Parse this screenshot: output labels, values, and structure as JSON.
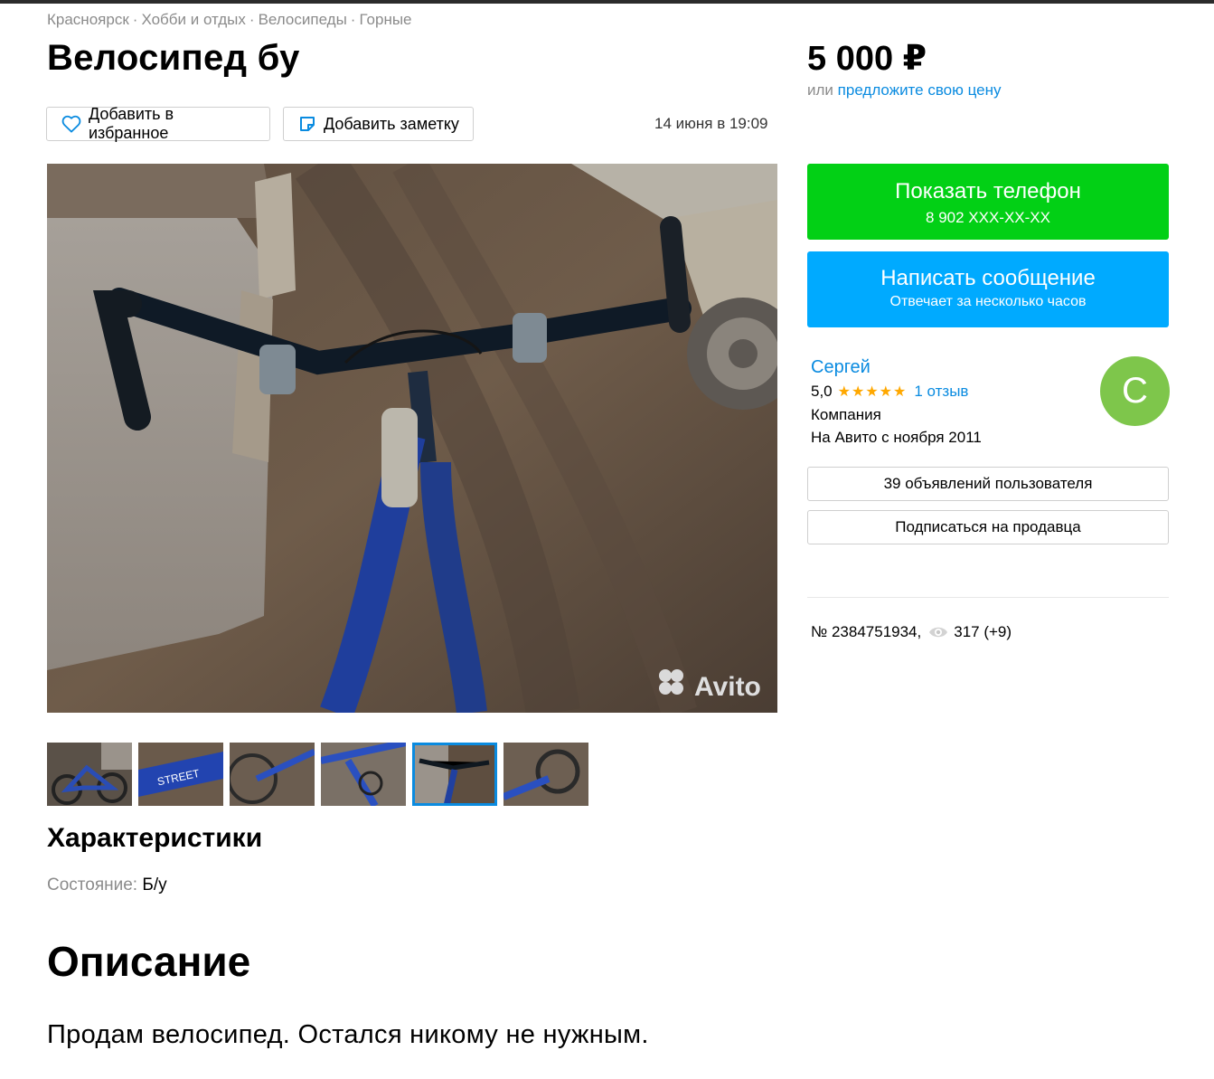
{
  "breadcrumb": [
    "Красноярск",
    "Хобби и отдых",
    "Велосипеды",
    "Горные"
  ],
  "title": "Велосипед бу",
  "price": "5 000 ₽",
  "price_offer": {
    "prefix": "или",
    "link": "предложите свою цену"
  },
  "actions": {
    "favorite": "Добавить в избранное",
    "note": "Добавить заметку"
  },
  "date": "14 июня в 19:09",
  "photo": {
    "watermark": "Avito"
  },
  "thumbnails": {
    "count": 6,
    "active_index": 4
  },
  "characteristics": {
    "heading": "Характеристики",
    "items": [
      {
        "key": "Состояние:",
        "value": "Б/у"
      }
    ]
  },
  "description": {
    "heading": "Описание",
    "text": "Продам велосипед. Остался никому не нужным."
  },
  "contact": {
    "phone_label": "Показать телефон",
    "phone_number": "8 902 XXX-XX-XX",
    "message_label": "Написать сообщение",
    "message_sub": "Отвечает за несколько часов"
  },
  "seller": {
    "name": "Сергей",
    "rating": "5,0",
    "stars": "★★★★★",
    "reviews": "1 отзыв",
    "type": "Компания",
    "since": "На Авито с ноября 2011",
    "avatar_letter": "С",
    "ads_button": "39 объявлений пользователя",
    "subscribe_button": "Подписаться на продавца"
  },
  "listing_meta": {
    "number": "№ 2384751934,",
    "views": "317 (+9)"
  },
  "colors": {
    "green": "#02d015",
    "blue": "#00aaff",
    "link": "#0a8be0",
    "star": "#ffa800",
    "avatar": "#7ec64b"
  }
}
